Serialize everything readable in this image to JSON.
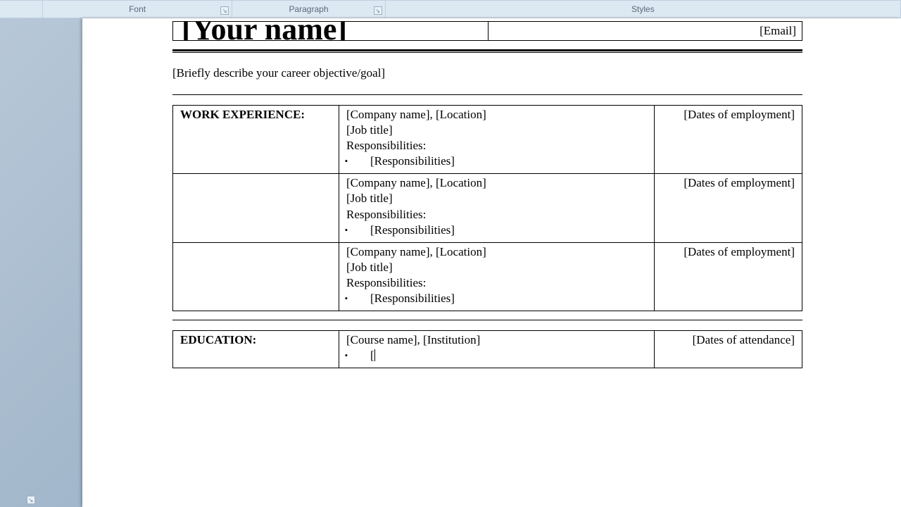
{
  "ribbon": {
    "font_label": "Font",
    "para_label": "Paragraph",
    "styles_label": "Styles"
  },
  "header": {
    "name": "[Your name]",
    "email": "[Email]"
  },
  "objective": "[Briefly describe your career objective/goal]",
  "work": {
    "heading": "WORK EXPERIENCE:",
    "entries": [
      {
        "company_loc": "[Company name], [Location]",
        "title": "[Job title]",
        "resp_label": "Responsibilities:",
        "bullet": "[Responsibilities]",
        "dates": "[Dates of employment]"
      },
      {
        "company_loc": "[Company name], [Location]",
        "title": "[Job title]",
        "resp_label": "Responsibilities:",
        "bullet": "[Responsibilities]",
        "dates": "[Dates of employment]"
      },
      {
        "company_loc": "[Company name], [Location]",
        "title": "[Job title]",
        "resp_label": "Responsibilities:",
        "bullet": "[Responsibilities]",
        "dates": "[Dates of employment]"
      }
    ]
  },
  "edu": {
    "heading": "EDUCATION:",
    "course_inst": "[Course name], [Institution]",
    "bullet_partial": "[",
    "dates": "[Dates of attendance]"
  }
}
